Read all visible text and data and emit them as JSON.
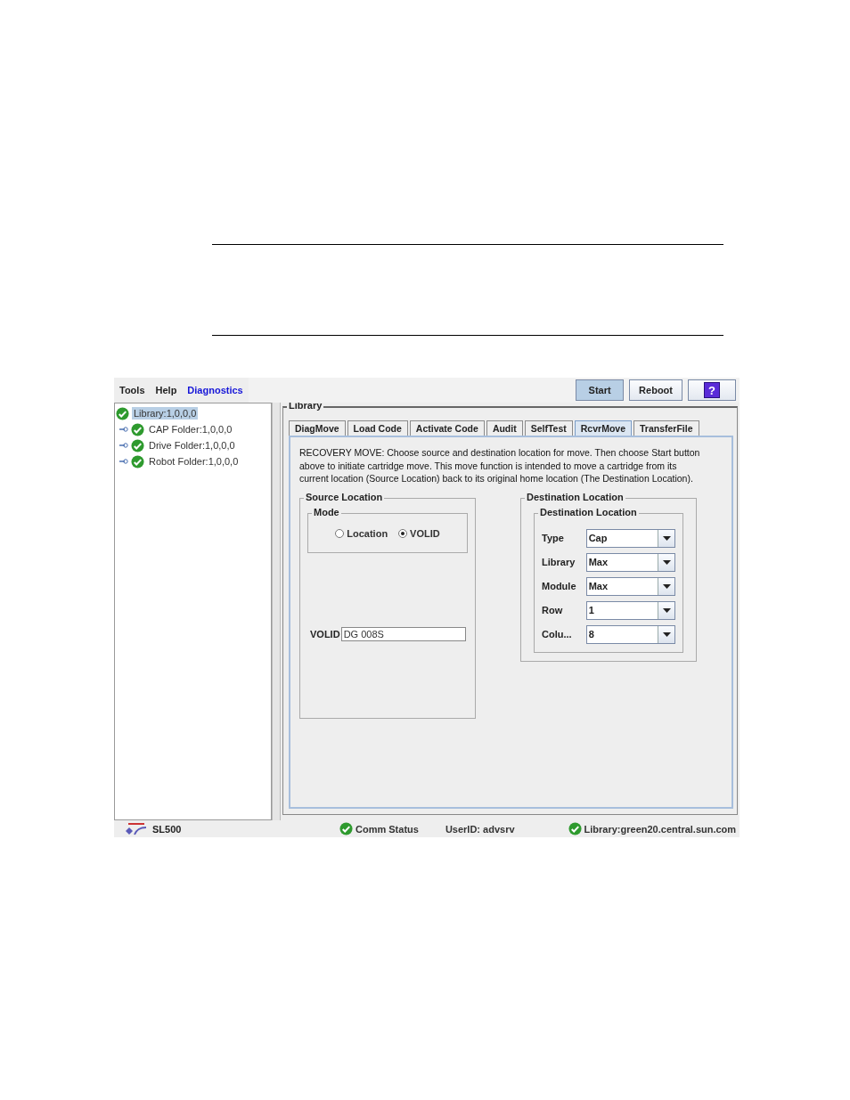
{
  "menu": [
    {
      "label": "Tools",
      "selected": false
    },
    {
      "label": "Help",
      "selected": false
    },
    {
      "label": "Diagnostics",
      "selected": true
    }
  ],
  "toolbar_buttons": [
    {
      "kind": "text",
      "label": "Start",
      "selected": true
    },
    {
      "kind": "text",
      "label": "Reboot",
      "selected": false
    },
    {
      "kind": "help",
      "label": "?",
      "selected": false
    }
  ],
  "tree": {
    "label": "Library:1,0,0,0",
    "selected": true,
    "children": [
      {
        "label": "CAP Folder:1,0,0,0",
        "selected": false
      },
      {
        "label": "Drive Folder:1,0,0,0",
        "selected": false
      },
      {
        "label": "Robot Folder:1,0,0,0",
        "selected": false
      }
    ]
  },
  "panel": {
    "title": "Library",
    "tabs": [
      {
        "label": "DiagMove",
        "selected": false
      },
      {
        "label": "Load Code",
        "selected": false
      },
      {
        "label": "Activate Code",
        "selected": false
      },
      {
        "label": "Audit",
        "selected": false
      },
      {
        "label": "SelfTest",
        "selected": false
      },
      {
        "label": "RcvrMove",
        "selected": true
      },
      {
        "label": "TransferFile",
        "selected": false
      }
    ],
    "description": "RECOVERY MOVE: Choose source and destination location for move. Then choose Start button above to initiate cartridge move. This move function is intended to move a cartridge from its current location (Source Location) back to its original home location (The Destination Location).",
    "source": {
      "title": "Source Location",
      "mode": {
        "title": "Mode",
        "options": [
          {
            "label": "Location",
            "selected": false
          },
          {
            "label": "VOLID",
            "selected": true
          }
        ]
      },
      "volid": {
        "label": "VOLID",
        "value": "DG 008S"
      }
    },
    "destination": {
      "title": "Destination Location",
      "inner_title": "Destination Location",
      "fields": [
        {
          "label": "Type",
          "value": "Cap"
        },
        {
          "label": "Library",
          "value": "Max"
        },
        {
          "label": "Module",
          "value": "Max"
        },
        {
          "label": "Row",
          "value": "1"
        },
        {
          "label": "Colu...",
          "value": "8"
        }
      ]
    }
  },
  "status_bar": {
    "product": "SL500",
    "items": [
      {
        "kind": "ok",
        "text": "Comm Status"
      },
      {
        "kind": "text",
        "text": "UserID: advsrv"
      },
      {
        "kind": "ok",
        "text": "Library:green20.central.sun.com"
      }
    ]
  }
}
